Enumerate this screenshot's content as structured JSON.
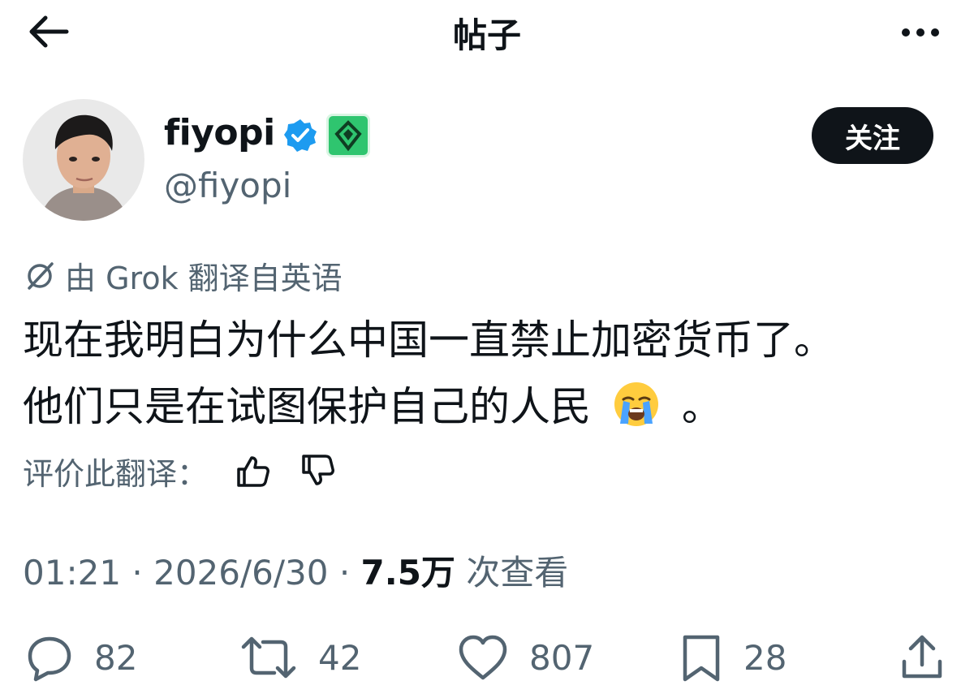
{
  "header": {
    "title": "帖子"
  },
  "author": {
    "display_name": "fiyopi",
    "handle": "@fiyopi",
    "follow_label": "关注",
    "verified_color": "#1d9bf0",
    "badge_color": "#2fc56f"
  },
  "translation": {
    "label": "由 Grok 翻译自英语"
  },
  "tweet": {
    "line1": "现在我明白为什么中国一直禁止加密货币了。",
    "line2": "他们只是在试图保护自己的人民",
    "line2_end": "。",
    "emoji": "loudly-crying-face"
  },
  "rating": {
    "label": "评价此翻译："
  },
  "meta": {
    "time": "01:21",
    "separator": " · ",
    "date": "2026/6/30",
    "views_count": "7.5万",
    "views_label": " 次查看"
  },
  "actions": {
    "replies": "82",
    "reposts": "42",
    "likes": "807",
    "bookmarks": "28"
  },
  "icons": [
    "back-arrow-icon",
    "more-icon",
    "verified-icon",
    "affiliate-badge-icon",
    "grok-icon",
    "thumbs-up-icon",
    "thumbs-down-icon",
    "reply-icon",
    "repost-icon",
    "like-icon",
    "bookmark-icon",
    "share-icon"
  ]
}
